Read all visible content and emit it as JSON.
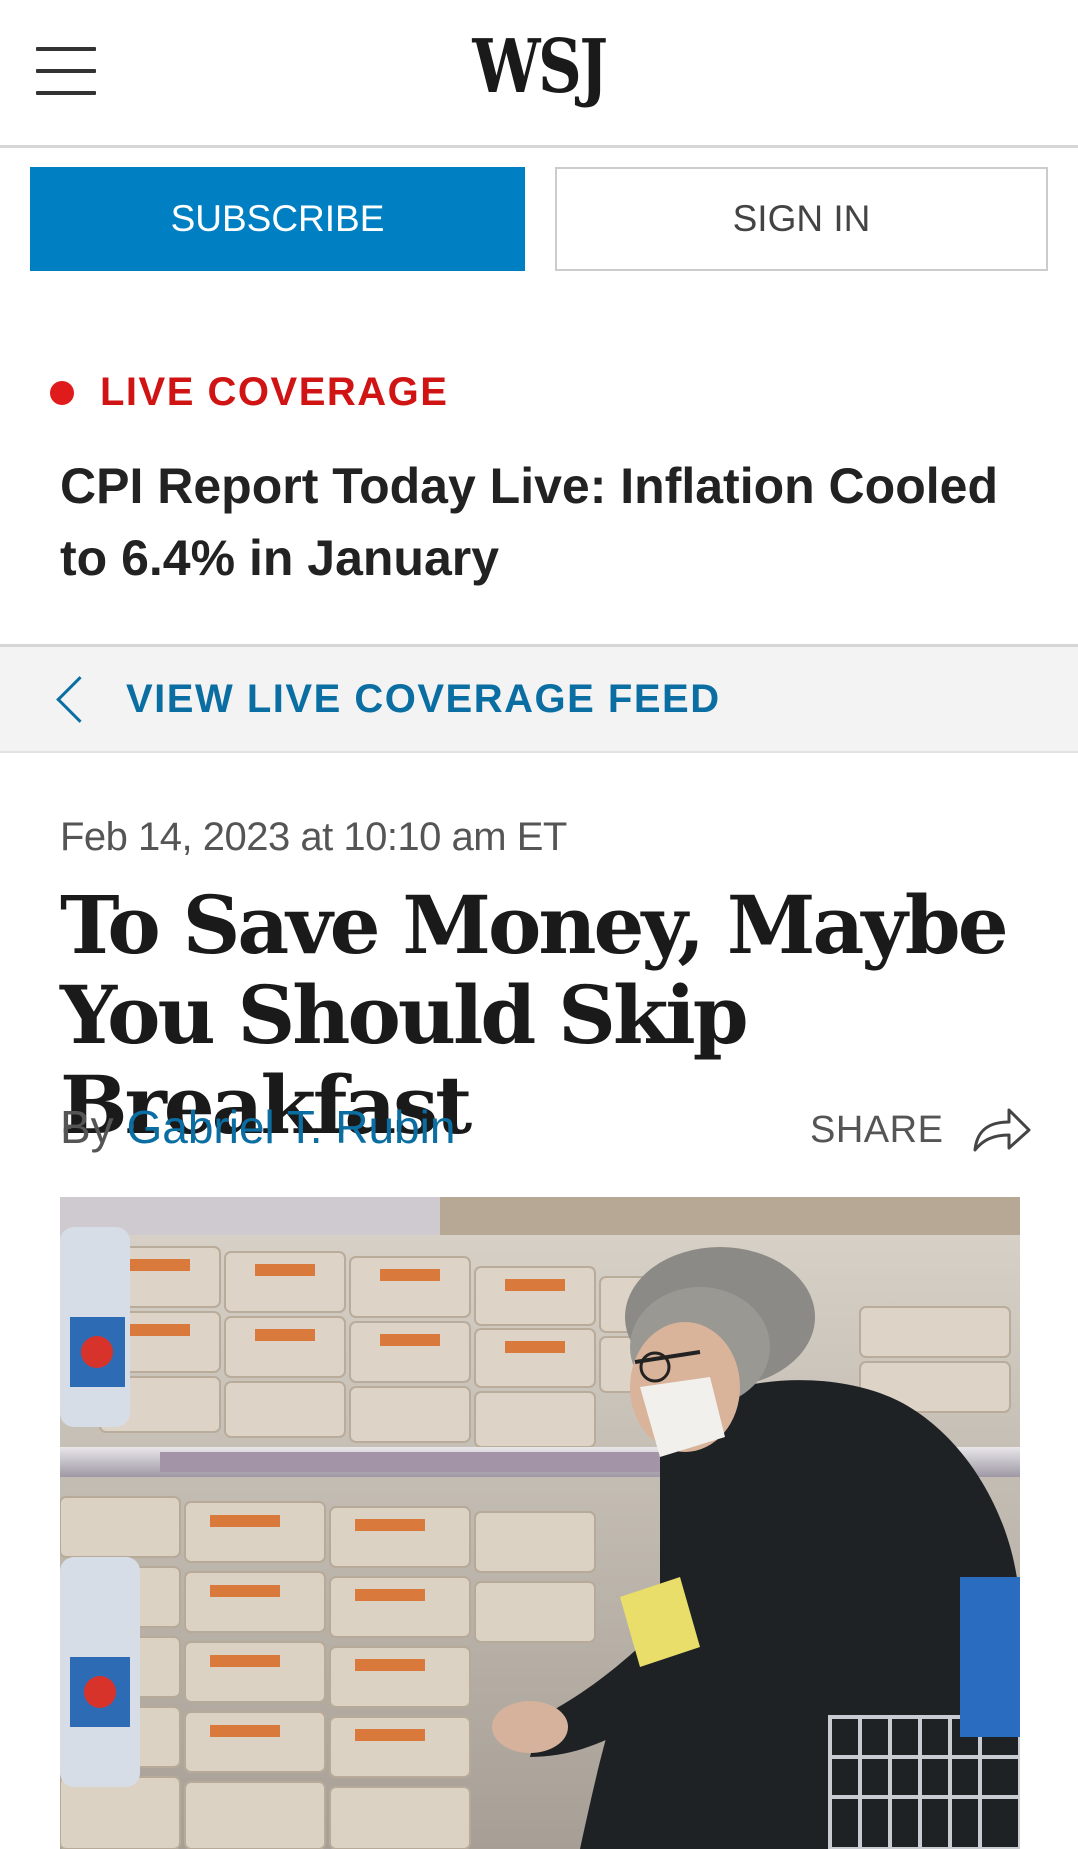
{
  "header": {
    "logo": "WSJ",
    "menu_icon": "hamburger-menu-icon"
  },
  "auth": {
    "subscribe_label": "SUBSCRIBE",
    "signin_label": "SIGN IN",
    "subscribe_color": "#0080c3"
  },
  "live": {
    "label": "LIVE COVERAGE",
    "headline": "CPI Report Today Live: Inflation Cooled to 6.4% in January",
    "dot_color": "#e01b1b"
  },
  "feed": {
    "label": "VIEW LIVE COVERAGE FEED",
    "icon": "chevron-left-icon"
  },
  "article": {
    "timestamp": "Feb 14, 2023 at 10:10 am ET",
    "title": "To Save Money, Maybe You Should Skip Breakfast",
    "byline_prefix": "By",
    "author": "Gabriel T. Rubin",
    "share_label": "SHARE",
    "share_icon": "share-arrow-icon",
    "link_color": "#0b6ea3"
  }
}
